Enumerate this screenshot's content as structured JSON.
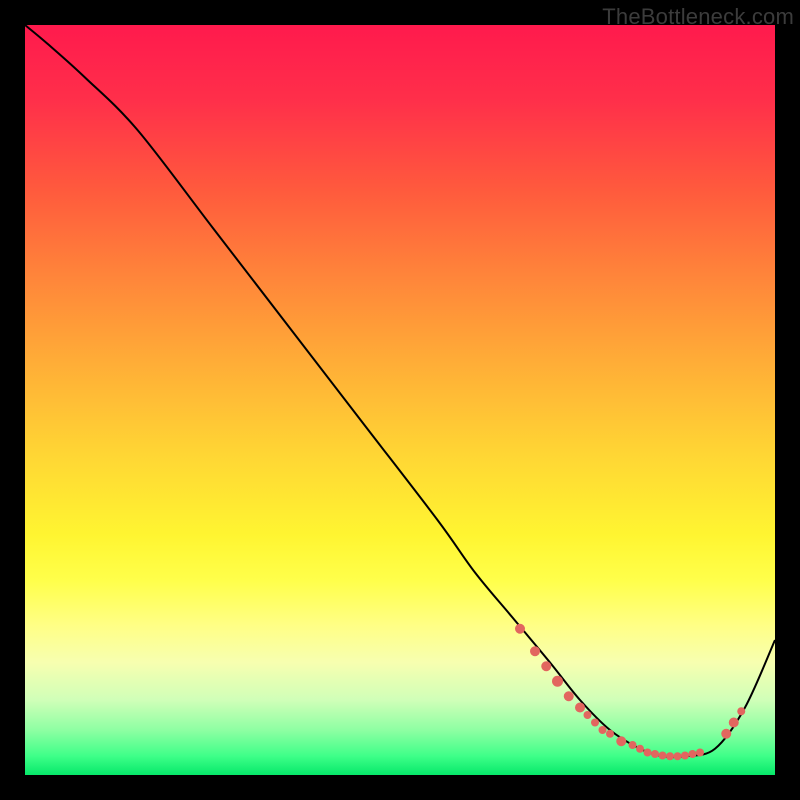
{
  "watermark": "TheBottleneck.com",
  "chart_data": {
    "type": "line",
    "title": "",
    "xlabel": "",
    "ylabel": "",
    "xlim": [
      0,
      100
    ],
    "ylim": [
      0,
      100
    ],
    "grid": false,
    "legend": false,
    "background_gradient": {
      "top_color": "#ff1a4d",
      "bottom_color": "#06e86a",
      "description": "Vertical rainbow gradient red-orange-yellow-green"
    },
    "series": [
      {
        "name": "bottleneck-curve",
        "x": [
          0,
          3,
          8,
          15,
          25,
          35,
          45,
          55,
          60,
          65,
          70,
          74,
          78,
          82,
          85,
          88,
          92,
          96,
          100
        ],
        "values": [
          100,
          97.5,
          93,
          86,
          73,
          60,
          47,
          34,
          27,
          21,
          15,
          10,
          6,
          3.5,
          2.5,
          2.5,
          3.5,
          9,
          18
        ],
        "stroke": "#000000",
        "stroke_width": 2
      }
    ],
    "markers": [
      {
        "x": 66,
        "y": 19.5,
        "color": "#e2665f",
        "r": 5
      },
      {
        "x": 68,
        "y": 16.5,
        "color": "#e2665f",
        "r": 5
      },
      {
        "x": 69.5,
        "y": 14.5,
        "color": "#e2665f",
        "r": 5
      },
      {
        "x": 71,
        "y": 12.5,
        "color": "#e2665f",
        "r": 5.5
      },
      {
        "x": 72.5,
        "y": 10.5,
        "color": "#e2665f",
        "r": 5
      },
      {
        "x": 74,
        "y": 9,
        "color": "#e2665f",
        "r": 5
      },
      {
        "x": 75,
        "y": 8,
        "color": "#e2665f",
        "r": 4
      },
      {
        "x": 76,
        "y": 7,
        "color": "#e2665f",
        "r": 4
      },
      {
        "x": 77,
        "y": 6,
        "color": "#e2665f",
        "r": 4
      },
      {
        "x": 78,
        "y": 5.5,
        "color": "#e2665f",
        "r": 4
      },
      {
        "x": 79.5,
        "y": 4.5,
        "color": "#e2665f",
        "r": 5
      },
      {
        "x": 81,
        "y": 4,
        "color": "#e2665f",
        "r": 4
      },
      {
        "x": 82,
        "y": 3.5,
        "color": "#e2665f",
        "r": 4
      },
      {
        "x": 83,
        "y": 3,
        "color": "#e2665f",
        "r": 4
      },
      {
        "x": 84,
        "y": 2.8,
        "color": "#e2665f",
        "r": 4
      },
      {
        "x": 85,
        "y": 2.6,
        "color": "#e2665f",
        "r": 4
      },
      {
        "x": 86,
        "y": 2.5,
        "color": "#e2665f",
        "r": 4
      },
      {
        "x": 87,
        "y": 2.5,
        "color": "#e2665f",
        "r": 4
      },
      {
        "x": 88,
        "y": 2.6,
        "color": "#e2665f",
        "r": 4
      },
      {
        "x": 89,
        "y": 2.8,
        "color": "#e2665f",
        "r": 4
      },
      {
        "x": 90,
        "y": 3,
        "color": "#e2665f",
        "r": 4
      },
      {
        "x": 93.5,
        "y": 5.5,
        "color": "#e2665f",
        "r": 5
      },
      {
        "x": 94.5,
        "y": 7,
        "color": "#e2665f",
        "r": 5
      },
      {
        "x": 95.5,
        "y": 8.5,
        "color": "#e2665f",
        "r": 4
      }
    ]
  }
}
